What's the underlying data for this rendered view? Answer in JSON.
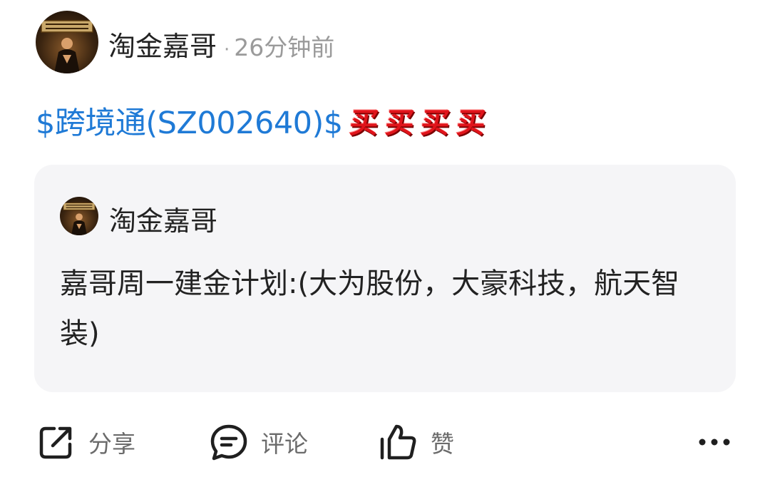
{
  "post": {
    "author": "淘金嘉哥",
    "separator": "·",
    "time": "26分钟前",
    "stock_link": "$跨境通(SZ002640)$",
    "buy_stickers": [
      "买",
      "买",
      "买",
      "买"
    ]
  },
  "quote": {
    "author": "淘金嘉哥",
    "text": "嘉哥周一建金计划:(大为股份，大豪科技，航天智装)"
  },
  "actions": {
    "share": "分享",
    "comment": "评论",
    "like": "赞"
  },
  "icons": {
    "share": "share-icon",
    "comment": "comment-icon",
    "like": "thumbs-up-icon",
    "more": "more-icon"
  },
  "colors": {
    "link": "#1f7ad6",
    "sticker": "#e0141b",
    "card_bg": "#f5f5f7",
    "muted": "#9a9a9a"
  }
}
